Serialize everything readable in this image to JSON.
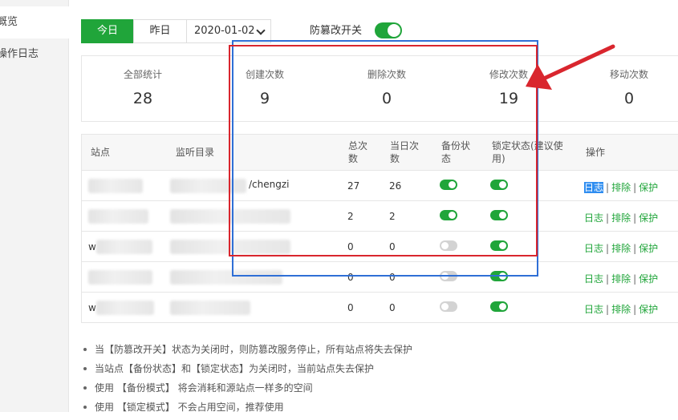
{
  "sidebar": {
    "items": [
      {
        "label": "概览",
        "active": true
      },
      {
        "label": "操作日志",
        "active": false
      }
    ]
  },
  "toolbar": {
    "today": "今日",
    "yesterday": "昨日",
    "date": "2020-01-02",
    "switch_label": "防篡改开关",
    "switch_on": true
  },
  "stats": [
    {
      "label": "全部统计",
      "value": "28"
    },
    {
      "label": "创建次数",
      "value": "9"
    },
    {
      "label": "删除次数",
      "value": "0"
    },
    {
      "label": "修改次数",
      "value": "19"
    },
    {
      "label": "移动次数",
      "value": "0"
    }
  ],
  "table": {
    "headers": {
      "site": "站点",
      "dir": "监听目录",
      "total": "总次\n数",
      "today": "当日次\n数",
      "backup": "备份状\n态",
      "lock": "锁定状态(建议使\n用)",
      "ops": "操作"
    },
    "rows": [
      {
        "site_prefix": "",
        "dir": "/chengzi",
        "total": "27",
        "today": "26",
        "backup": true,
        "lock": true
      },
      {
        "site_prefix": "",
        "dir": "",
        "total": "2",
        "today": "2",
        "backup": true,
        "lock": true
      },
      {
        "site_prefix": "w",
        "dir": "",
        "total": "0",
        "today": "0",
        "backup": false,
        "lock": true
      },
      {
        "site_prefix": "",
        "dir": "",
        "total": "0",
        "today": "0",
        "backup": false,
        "lock": true
      },
      {
        "site_prefix": "w",
        "dir": "",
        "total": "0",
        "today": "0",
        "backup": false,
        "lock": true
      }
    ],
    "op_log": "日志",
    "op_exclude": "排除",
    "op_protect": "保护",
    "op_sep": "|"
  },
  "notes": [
    "当【防篡改开关】状态为关闭时，则防篡改服务停止，所有站点将失去保护",
    "当站点【备份状态】和【锁定状态】为关闭时，当前站点失去保护",
    "使用 【备份模式】 将会消耗和源站点一样多的空间",
    "使用 【锁定模式】 不会占用空间，推荐使用"
  ],
  "colors": {
    "accent": "#20a53a",
    "annotation_red": "#d9262e",
    "annotation_blue": "#2f6fd6"
  }
}
